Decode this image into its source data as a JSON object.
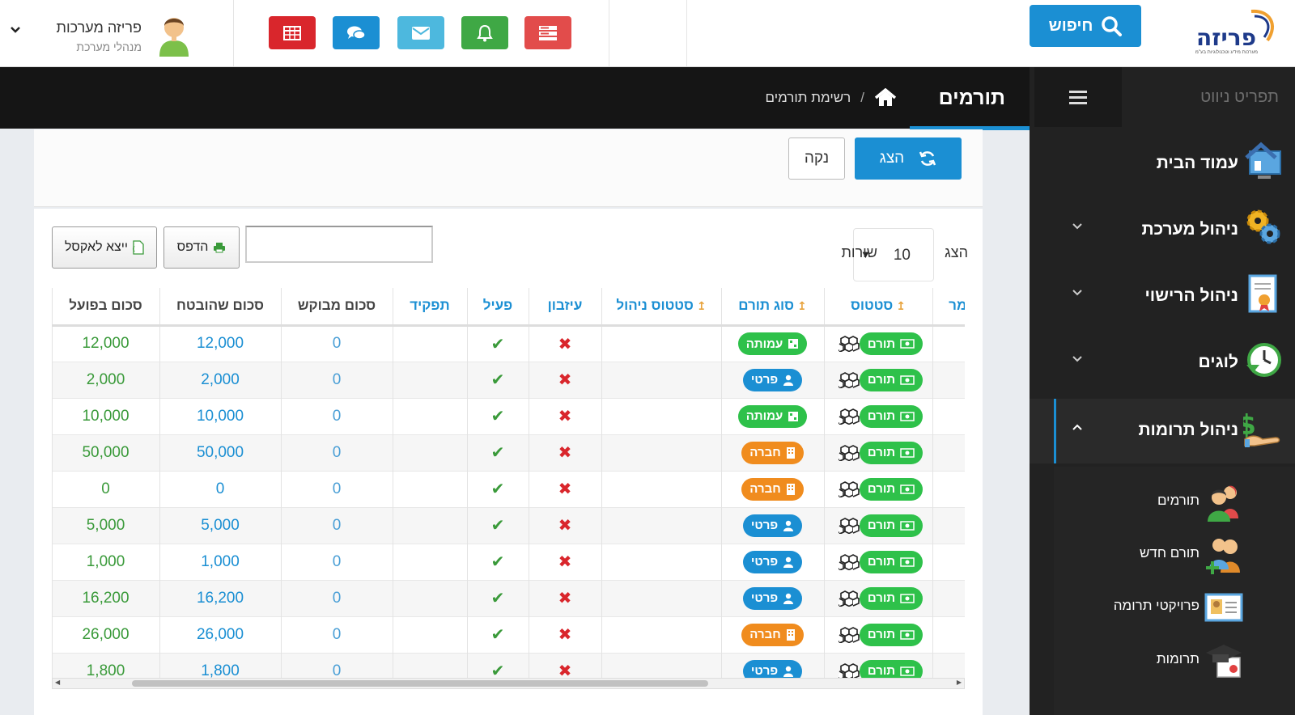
{
  "topbar": {
    "logo_text": "פריזה",
    "logo_sub": "מערכות מידע וטכנולוגיות בע\"מ",
    "search_label": "חיפוש",
    "user_name": "פריזה מערכות",
    "user_role": "מנהלי מערכת",
    "quick_buttons": [
      {
        "icon": "server-icon",
        "color": "#e24c4b"
      },
      {
        "icon": "bell-icon",
        "color": "#3fa845"
      },
      {
        "icon": "envelope-icon",
        "color": "#4db8de"
      },
      {
        "icon": "comments-icon",
        "color": "#1b8fd3"
      },
      {
        "icon": "table-icon",
        "color": "#d9262c"
      }
    ]
  },
  "sidebar": {
    "title": "תפריט ניווט",
    "items": [
      {
        "label": "עמוד הבית",
        "icon": "home-screen-icon",
        "expandable": false
      },
      {
        "label": "ניהול מערכת",
        "icon": "gears-icon",
        "expandable": true
      },
      {
        "label": "ניהול הרישוי",
        "icon": "certificate-icon",
        "expandable": true
      },
      {
        "label": "לוגים",
        "icon": "clock-icon",
        "expandable": true
      },
      {
        "label": "ניהול תרומות",
        "icon": "money-hand-icon",
        "expandable": true,
        "active": true
      }
    ],
    "subitems": [
      {
        "label": "תורמים",
        "icon": "users-icon"
      },
      {
        "label": "תורם חדש",
        "icon": "add-user-icon"
      },
      {
        "label": "פרויקטי תרומה",
        "icon": "id-card-icon"
      },
      {
        "label": "תרומות",
        "icon": "graduation-icon"
      }
    ]
  },
  "header": {
    "title": "תורמים",
    "breadcrumb": "רשימת תורמים"
  },
  "filters": {
    "show_label": "הצג",
    "clear_label": "נקה"
  },
  "table_controls": {
    "show_label": "הצג",
    "rows_value": "10",
    "rows_label": "שורות",
    "search_value": "",
    "print_label": "הדפס",
    "excel_label": "ייצא לאקסל"
  },
  "table": {
    "columns": [
      {
        "label": "מר",
        "sortable": false,
        "style": "blue"
      },
      {
        "label": "סטטוס",
        "sortable": true,
        "style": "blue"
      },
      {
        "label": "סוג תורם",
        "sortable": true,
        "style": "blue"
      },
      {
        "label": "סטטוס ניהול",
        "sortable": true,
        "style": "blue"
      },
      {
        "label": "עיזבון",
        "sortable": false,
        "style": "blue"
      },
      {
        "label": "פעיל",
        "sortable": false,
        "style": "blue"
      },
      {
        "label": "תפקיד",
        "sortable": false,
        "style": "blue"
      },
      {
        "label": "סכום מבוקש",
        "sortable": false,
        "style": "gray"
      },
      {
        "label": "סכום שהובטח",
        "sortable": false,
        "style": "gray"
      },
      {
        "label": "סכום בפועל",
        "sortable": false,
        "style": "gray"
      }
    ],
    "rows": [
      {
        "status": "תורם",
        "type": "עמותה",
        "type_color": "green",
        "estate": "✖",
        "active": "✔",
        "requested": "0",
        "promised": "12,000",
        "actual": "12,000"
      },
      {
        "status": "תורם",
        "type": "פרטי",
        "type_color": "blue",
        "estate": "✖",
        "active": "✔",
        "requested": "0",
        "promised": "2,000",
        "actual": "2,000"
      },
      {
        "status": "תורם",
        "type": "עמותה",
        "type_color": "green",
        "estate": "✖",
        "active": "✔",
        "requested": "0",
        "promised": "10,000",
        "actual": "10,000"
      },
      {
        "status": "תורם",
        "type": "חברה",
        "type_color": "orange",
        "estate": "✖",
        "active": "✔",
        "requested": "0",
        "promised": "50,000",
        "actual": "50,000"
      },
      {
        "status": "תורם",
        "type": "חברה",
        "type_color": "orange",
        "estate": "✖",
        "active": "✔",
        "requested": "0",
        "promised": "0",
        "actual": "0"
      },
      {
        "status": "תורם",
        "type": "פרטי",
        "type_color": "blue",
        "estate": "✖",
        "active": "✔",
        "requested": "0",
        "promised": "5,000",
        "actual": "5,000"
      },
      {
        "status": "תורם",
        "type": "פרטי",
        "type_color": "blue",
        "estate": "✖",
        "active": "✔",
        "requested": "0",
        "promised": "1,000",
        "actual": "1,000"
      },
      {
        "status": "תורם",
        "type": "פרטי",
        "type_color": "blue",
        "estate": "✖",
        "active": "✔",
        "requested": "0",
        "promised": "16,200",
        "actual": "16,200"
      },
      {
        "status": "תורם",
        "type": "חברה",
        "type_color": "orange",
        "estate": "✖",
        "active": "✔",
        "requested": "0",
        "promised": "26,000",
        "actual": "26,000"
      },
      {
        "status": "תורם",
        "type": "פרטי",
        "type_color": "blue",
        "estate": "✖",
        "active": "✔",
        "requested": "0",
        "promised": "1,800",
        "actual": "1,800"
      }
    ]
  }
}
